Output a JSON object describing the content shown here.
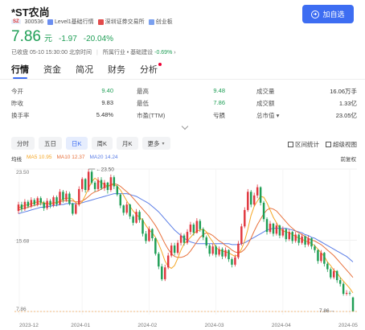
{
  "header": {
    "title": "*ST农尚",
    "market_badge": "SZ",
    "code": "300536",
    "tags": [
      "Level1基础行情",
      "深圳证券交易所",
      "创业板"
    ],
    "add_button_label": "加自选"
  },
  "price": {
    "last": "7.86",
    "unit": "元",
    "change": "-1.97",
    "change_pct": "-20.04%"
  },
  "status": {
    "text": "已收盘 05-10 15:30:00 北京时间",
    "industry": "所属行业 • 基础建设",
    "industry_pct": "-0.69%",
    "arrow": "›"
  },
  "tabs": [
    "行情",
    "资金",
    "简况",
    "财务",
    "分析"
  ],
  "quote": {
    "open_label": "今开",
    "open": "9.40",
    "high_label": "最高",
    "high": "9.48",
    "volume_label": "成交量",
    "volume": "16.06万手",
    "prev_close_label": "昨收",
    "prev_close": "9.83",
    "low_label": "最低",
    "low": "7.86",
    "amount_label": "成交额",
    "amount": "1.33亿",
    "turnover_label": "换手率",
    "turnover": "5.48%",
    "pe_label": "市盈(TTM)",
    "pe": "亏损",
    "mktcap_label": "总市值",
    "mktcap": "23.05亿"
  },
  "periods": [
    "分时",
    "五日",
    "日K",
    "周K",
    "月K",
    "更多"
  ],
  "tools": {
    "interval_stats": "区间统计",
    "super_view": "超级视图"
  },
  "ma": {
    "label": "均线",
    "ma5": "MA5 10.95",
    "ma10": "MA10 12.37",
    "ma20": "MA20 14.24",
    "adjust": "前复权"
  },
  "colors": {
    "up": "#e0373f",
    "down": "#1e9e55",
    "accent": "#3d6df2",
    "ma5": "#f5a623",
    "ma10": "#e8713c",
    "ma20": "#5a7de6"
  },
  "chart_data": {
    "type": "candlestick",
    "y_ticks": [
      "23.50",
      "15.68",
      "7.86"
    ],
    "x_ticks": [
      "2023-12",
      "2024-01",
      "2024-02",
      "2024-03",
      "2024-04",
      "2024-05"
    ],
    "max_label": "23.50",
    "min_label": "7.86",
    "ylim": [
      7.86,
      23.5
    ],
    "candles": [
      [
        18.9,
        19.6,
        19.9,
        18.6
      ],
      [
        19.6,
        19.1,
        19.9,
        18.8
      ],
      [
        19.1,
        19.9,
        20.2,
        18.9
      ],
      [
        19.9,
        19.4,
        20.1,
        19.2
      ],
      [
        19.4,
        20.1,
        20.4,
        19.2
      ],
      [
        20.1,
        19.6,
        20.3,
        19.4
      ],
      [
        19.6,
        20.3,
        20.5,
        19.4
      ],
      [
        20.3,
        19.8,
        20.5,
        19.5
      ],
      [
        19.8,
        19.2,
        20.0,
        18.9
      ],
      [
        19.2,
        20.0,
        20.3,
        19.0
      ],
      [
        20.0,
        19.5,
        20.2,
        19.2
      ],
      [
        19.5,
        20.4,
        20.6,
        19.3
      ],
      [
        20.4,
        19.6,
        20.6,
        19.4
      ],
      [
        19.6,
        21.0,
        21.3,
        19.5
      ],
      [
        21.0,
        20.1,
        21.2,
        19.8
      ],
      [
        20.1,
        20.8,
        21.1,
        19.9
      ],
      [
        20.8,
        19.7,
        21.0,
        19.5
      ],
      [
        19.7,
        18.6,
        19.8,
        18.4
      ],
      [
        18.6,
        19.6,
        19.8,
        18.5
      ],
      [
        19.6,
        21.3,
        21.6,
        19.4
      ],
      [
        21.3,
        22.4,
        22.6,
        21.0
      ],
      [
        22.4,
        21.2,
        22.5,
        20.9
      ],
      [
        21.2,
        23.2,
        23.5,
        21.0
      ],
      [
        23.2,
        22.0,
        23.4,
        21.8
      ],
      [
        22.0,
        21.3,
        22.2,
        21.0
      ],
      [
        21.3,
        22.3,
        22.6,
        21.1
      ],
      [
        22.3,
        21.4,
        22.6,
        21.2
      ],
      [
        21.4,
        22.0,
        22.3,
        21.1
      ],
      [
        22.0,
        21.2,
        22.1,
        20.8
      ],
      [
        21.2,
        22.6,
        22.9,
        21.0
      ],
      [
        22.6,
        21.6,
        22.8,
        21.3
      ],
      [
        21.6,
        20.7,
        21.8,
        20.5
      ],
      [
        20.7,
        19.5,
        20.8,
        19.2
      ],
      [
        19.5,
        18.7,
        19.6,
        18.4
      ],
      [
        18.7,
        19.6,
        19.9,
        18.5
      ],
      [
        19.6,
        18.3,
        19.7,
        18.0
      ],
      [
        18.3,
        17.6,
        18.5,
        17.3
      ],
      [
        17.6,
        18.8,
        19.1,
        17.5
      ],
      [
        18.8,
        17.9,
        19.0,
        17.6
      ],
      [
        17.9,
        16.4,
        18.1,
        16.1
      ],
      [
        16.4,
        15.6,
        16.7,
        15.3
      ],
      [
        15.6,
        16.9,
        17.2,
        15.5
      ],
      [
        16.9,
        15.9,
        17.0,
        15.6
      ],
      [
        15.9,
        14.2,
        16.0,
        14.0
      ],
      [
        14.2,
        12.8,
        14.4,
        12.5
      ],
      [
        12.8,
        11.4,
        13.1,
        11.2
      ],
      [
        11.4,
        12.7,
        13.0,
        11.2
      ],
      [
        12.7,
        14.0,
        14.3,
        12.5
      ],
      [
        14.0,
        15.1,
        15.4,
        13.8
      ],
      [
        15.1,
        14.3,
        15.4,
        14.0
      ],
      [
        14.3,
        15.4,
        15.7,
        14.1
      ],
      [
        15.4,
        16.2,
        16.5,
        15.1
      ],
      [
        16.2,
        15.4,
        16.4,
        15.1
      ],
      [
        15.4,
        16.6,
        16.9,
        15.2
      ],
      [
        16.6,
        17.4,
        17.7,
        16.3
      ],
      [
        17.4,
        16.5,
        17.6,
        16.2
      ],
      [
        16.5,
        17.8,
        18.1,
        16.4
      ],
      [
        17.8,
        16.9,
        18.0,
        16.6
      ],
      [
        16.9,
        16.0,
        17.1,
        15.7
      ],
      [
        16.0,
        15.1,
        16.2,
        14.8
      ],
      [
        15.1,
        14.2,
        15.3,
        13.9
      ],
      [
        14.2,
        15.0,
        15.3,
        14.0
      ],
      [
        15.0,
        14.1,
        15.2,
        13.8
      ],
      [
        14.1,
        14.7,
        15.0,
        13.9
      ],
      [
        14.7,
        13.9,
        14.9,
        13.6
      ],
      [
        13.9,
        14.6,
        14.9,
        13.7
      ],
      [
        14.6,
        13.6,
        14.7,
        13.3
      ],
      [
        13.6,
        13.0,
        13.8,
        12.7
      ],
      [
        13.0,
        13.8,
        14.1,
        12.8
      ],
      [
        13.8,
        15.3,
        15.6,
        13.6
      ],
      [
        15.3,
        17.2,
        17.5,
        15.1
      ],
      [
        17.2,
        19.0,
        19.3,
        17.0
      ],
      [
        19.0,
        21.0,
        21.3,
        18.8
      ],
      [
        21.0,
        19.6,
        21.2,
        19.3
      ],
      [
        19.6,
        20.6,
        20.9,
        19.4
      ],
      [
        20.6,
        21.5,
        21.8,
        20.3
      ],
      [
        21.5,
        19.8,
        21.6,
        19.5
      ],
      [
        19.8,
        18.0,
        20.0,
        17.7
      ],
      [
        18.0,
        16.6,
        18.2,
        16.3
      ],
      [
        16.6,
        17.5,
        17.8,
        16.4
      ],
      [
        17.5,
        16.4,
        17.6,
        16.1
      ],
      [
        16.4,
        17.3,
        17.6,
        16.2
      ],
      [
        17.3,
        16.2,
        17.4,
        15.9
      ],
      [
        16.2,
        16.9,
        17.2,
        16.0
      ],
      [
        16.9,
        15.8,
        17.0,
        15.5
      ],
      [
        15.8,
        16.6,
        16.9,
        15.6
      ],
      [
        16.6,
        15.6,
        16.7,
        15.3
      ],
      [
        15.6,
        16.3,
        16.6,
        15.4
      ],
      [
        16.3,
        15.4,
        16.4,
        15.1
      ],
      [
        15.4,
        16.1,
        16.4,
        15.2
      ],
      [
        16.1,
        15.2,
        16.2,
        14.9
      ],
      [
        15.2,
        15.9,
        16.2,
        15.0
      ],
      [
        15.9,
        15.0,
        16.0,
        14.7
      ],
      [
        15.0,
        14.6,
        15.2,
        14.3
      ],
      [
        14.6,
        13.4,
        14.7,
        13.1
      ],
      [
        13.4,
        14.3,
        14.6,
        13.2
      ],
      [
        14.3,
        13.1,
        14.4,
        12.8
      ],
      [
        13.1,
        12.5,
        13.3,
        12.2
      ],
      [
        12.5,
        11.6,
        12.7,
        11.4
      ],
      [
        11.6,
        12.3,
        12.6,
        11.4
      ],
      [
        12.3,
        11.3,
        12.4,
        11.0
      ],
      [
        11.3,
        10.9,
        11.6,
        10.6
      ],
      [
        10.9,
        9.8,
        11.1,
        9.6
      ],
      [
        9.8,
        9.9,
        10.2,
        9.6
      ],
      [
        9.9,
        9.83,
        10.1,
        9.6
      ],
      [
        9.4,
        7.86,
        9.48,
        7.86
      ]
    ],
    "ma5": [
      19.2,
      19.4,
      19.5,
      19.6,
      19.7,
      19.8,
      19.9,
      19.9,
      19.8,
      19.7,
      19.7,
      19.8,
      19.8,
      20.0,
      20.2,
      20.3,
      20.3,
      20.2,
      19.8,
      19.6,
      19.9,
      20.6,
      21.4,
      22.1,
      22.5,
      22.2,
      22.0,
      21.8,
      21.6,
      21.7,
      21.8,
      21.6,
      21.2,
      20.6,
      20.0,
      19.4,
      18.9,
      18.5,
      18.2,
      17.9,
      17.3,
      16.8,
      16.5,
      16.0,
      15.3,
      14.4,
      13.4,
      12.8,
      12.6,
      12.9,
      13.7,
      14.6,
      15.3,
      15.6,
      16.0,
      16.4,
      16.7,
      16.8,
      16.9,
      16.6,
      16.0,
      15.5,
      14.9,
      14.6,
      14.5,
      14.4,
      14.3,
      14.1,
      13.9,
      14.1,
      14.7,
      15.6,
      16.9,
      18.4,
      19.4,
      20.0,
      20.5,
      20.4,
      19.8,
      19.0,
      18.2,
      17.6,
      17.0,
      16.7,
      16.6,
      16.5,
      16.3,
      16.1,
      15.9,
      15.8,
      15.6,
      15.5,
      15.3,
      15.1,
      14.7,
      14.3,
      13.9,
      13.3,
      12.9,
      12.4,
      12.1,
      11.6,
      11.2,
      10.8,
      10.4,
      9.9
    ],
    "ma10": [
      19.0,
      19.1,
      19.2,
      19.3,
      19.4,
      19.5,
      19.6,
      19.7,
      19.7,
      19.7,
      19.7,
      19.8,
      19.8,
      19.9,
      20.0,
      20.0,
      20.0,
      20.0,
      19.9,
      19.9,
      20.0,
      20.2,
      20.5,
      20.8,
      21.0,
      21.1,
      21.3,
      21.5,
      21.6,
      21.8,
      21.9,
      21.8,
      21.6,
      21.3,
      21.0,
      20.7,
      20.3,
      19.9,
      19.5,
      19.1,
      18.7,
      18.3,
      17.8,
      17.3,
      16.7,
      16.0,
      15.3,
      14.7,
      14.2,
      13.9,
      13.8,
      13.8,
      13.9,
      14.1,
      14.5,
      15.0,
      15.5,
      16.0,
      16.3,
      16.5,
      16.4,
      16.2,
      15.9,
      15.6,
      15.4,
      15.1,
      14.9,
      14.6,
      14.4,
      14.3,
      14.4,
      14.7,
      15.2,
      15.9,
      16.7,
      17.4,
      18.0,
      18.6,
      19.0,
      19.2,
      19.1,
      18.9,
      18.5,
      18.1,
      17.7,
      17.3,
      17.0,
      16.7,
      16.5,
      16.3,
      16.1,
      15.9,
      15.7,
      15.6,
      15.4,
      15.2,
      14.9,
      14.6,
      14.3,
      14.0,
      13.6,
      13.2,
      12.8,
      12.4,
      12.0,
      11.6
    ],
    "ma20": [
      18.6,
      18.7,
      18.8,
      18.9,
      19.0,
      19.1,
      19.2,
      19.3,
      19.3,
      19.4,
      19.4,
      19.5,
      19.5,
      19.6,
      19.6,
      19.7,
      19.7,
      19.7,
      19.7,
      19.7,
      19.8,
      19.9,
      20.0,
      20.1,
      20.2,
      20.3,
      20.4,
      20.5,
      20.6,
      20.7,
      20.8,
      20.8,
      20.8,
      20.8,
      20.8,
      20.7,
      20.6,
      20.5,
      20.3,
      20.1,
      19.9,
      19.7,
      19.4,
      19.1,
      18.8,
      18.4,
      18.0,
      17.6,
      17.2,
      16.8,
      16.5,
      16.2,
      15.9,
      15.7,
      15.5,
      15.4,
      15.3,
      15.3,
      15.3,
      15.3,
      15.3,
      15.3,
      15.3,
      15.3,
      15.3,
      15.3,
      15.3,
      15.2,
      15.2,
      15.2,
      15.3,
      15.4,
      15.6,
      15.8,
      16.0,
      16.2,
      16.4,
      16.6,
      16.8,
      16.9,
      17.0,
      17.0,
      17.0,
      17.0,
      17.0,
      16.9,
      16.8,
      16.7,
      16.6,
      16.5,
      16.3,
      16.2,
      16.0,
      15.9,
      15.7,
      15.5,
      15.3,
      15.1,
      14.9,
      14.7,
      14.5,
      14.3,
      14.1,
      13.9,
      13.6,
      13.3
    ]
  }
}
